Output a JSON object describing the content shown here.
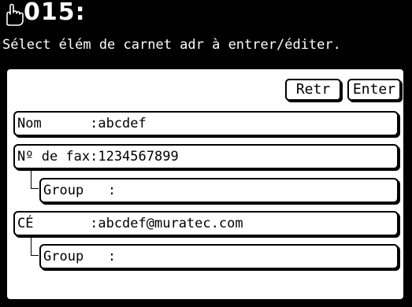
{
  "header": {
    "code": "015:",
    "instruction": "Sélect élém de carnet adr à entrer/éditer."
  },
  "buttons": {
    "retr_label": "Retr",
    "enter_label": "Enter"
  },
  "fields": {
    "name": "Nom      :abcdef",
    "fax": "Nº de fax:1234567899",
    "group1": "Group   :",
    "email": "CÉ       :abcdef@muratec.com",
    "group2": "Group   :"
  },
  "icons": {
    "hand": "hand-pointer-icon"
  },
  "colors": {
    "background": "#000000",
    "panel": "#ffffff",
    "text_on_dark": "#ffffff"
  }
}
